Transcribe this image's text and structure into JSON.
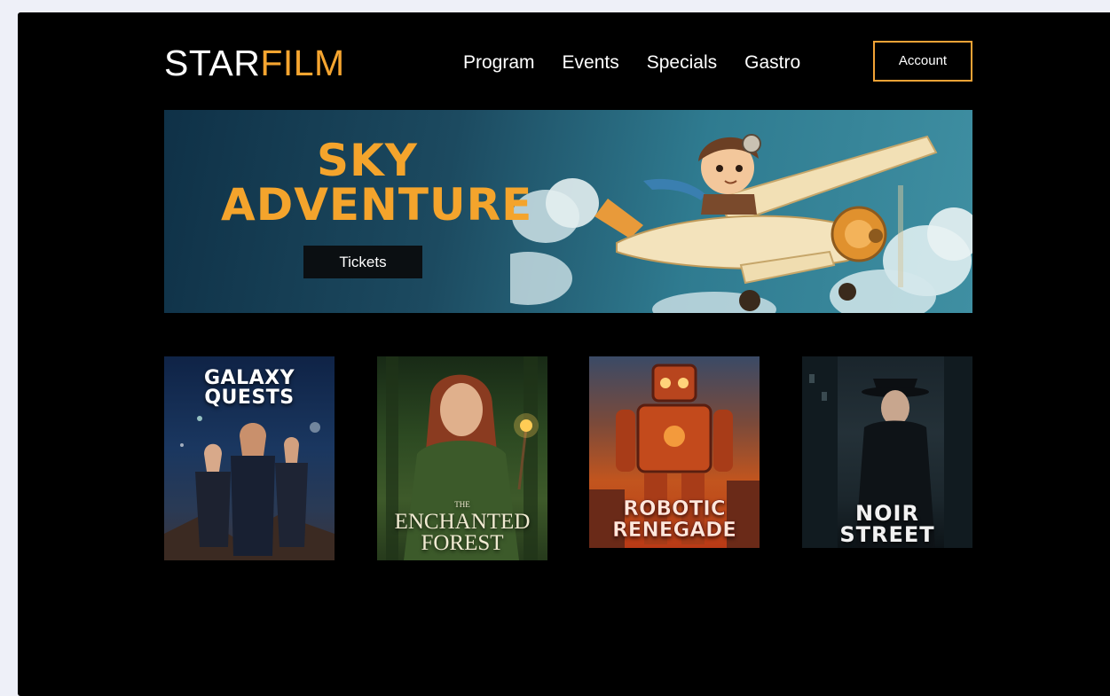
{
  "header": {
    "logo_primary": "STAR",
    "logo_accent": "FILM",
    "nav": [
      "Program",
      "Events",
      "Specials",
      "Gastro"
    ],
    "account_label": "Account"
  },
  "hero": {
    "title_line1": "SKY",
    "title_line2": "ADVENTURE",
    "tickets_label": "Tickets"
  },
  "posters": [
    {
      "title_line1": "GALAXY",
      "title_line2": "QUESTS"
    },
    {
      "prefix": "THE",
      "title_line1": "ENCHANTED",
      "title_line2": "FOREST"
    },
    {
      "title_line1": "ROBOTIC",
      "title_line2": "RENEGADE"
    },
    {
      "title_line1": "NOIR",
      "title_line2": "STREET"
    }
  ],
  "colors": {
    "accent": "#f6a530",
    "background": "#000000",
    "hero_sky": "#2f7b90"
  }
}
